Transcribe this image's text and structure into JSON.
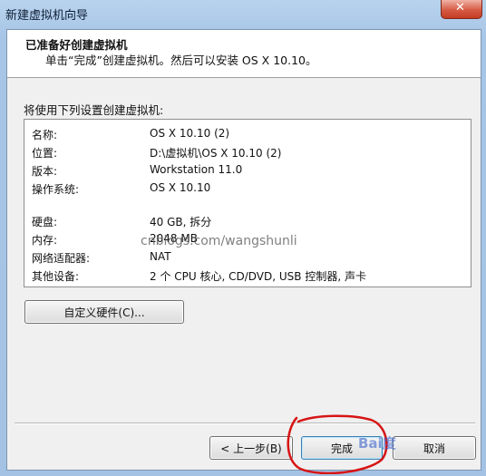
{
  "window": {
    "title": "新建虚拟机向导"
  },
  "header": {
    "title": "已准备好创建虚拟机",
    "subtitle": "单击“完成”创建虚拟机。然后可以安装 OS X 10.10。"
  },
  "intro_text": "将使用下列设置创建虚拟机:",
  "settings": [
    {
      "label": "名称:",
      "value": "OS X 10.10 (2)"
    },
    {
      "label": "位置:",
      "value": "D:\\虚拟机\\OS X 10.10 (2)"
    },
    {
      "label": "版本:",
      "value": "Workstation 11.0"
    },
    {
      "label": "操作系统:",
      "value": "OS X 10.10"
    },
    {
      "label": "硬盘:",
      "value": "40 GB, 拆分"
    },
    {
      "label": "内存:",
      "value": "2048 MB"
    },
    {
      "label": "网络适配器:",
      "value": "NAT"
    },
    {
      "label": "其他设备:",
      "value": "2 个 CPU 核心, CD/DVD, USB 控制器, 声卡"
    }
  ],
  "watermark": "cnblogs.com/wangshunli",
  "buttons": {
    "customize": "自定义硬件(C)...",
    "back": "< 上一步(B)",
    "finish": "完成",
    "cancel": "取消"
  },
  "baidu_watermark": "Bai度"
}
